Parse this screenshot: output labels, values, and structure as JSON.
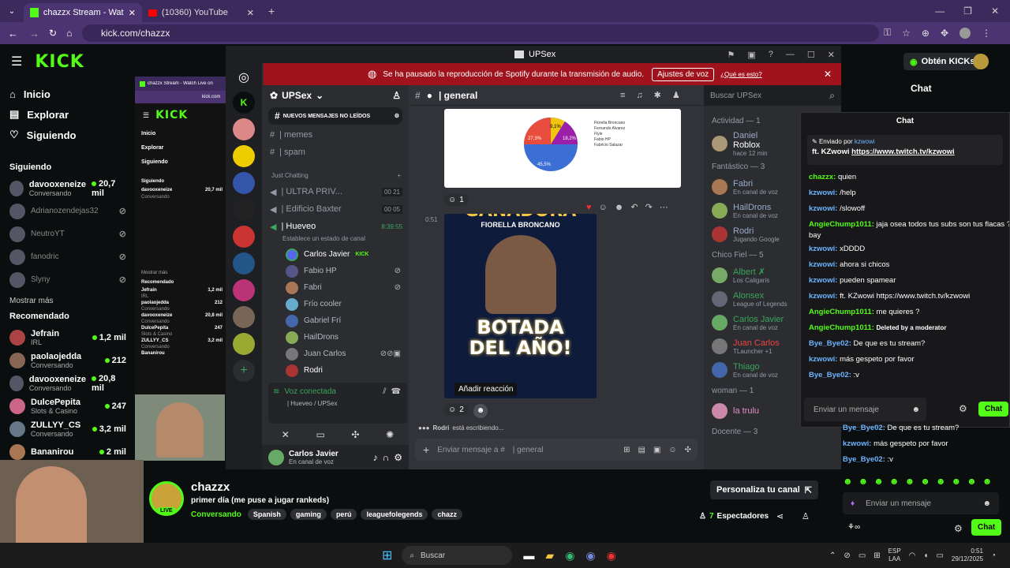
{
  "browser": {
    "tabs": [
      {
        "label": "chazzx Stream - Watch Live on",
        "active": true
      },
      {
        "label": "(10360) YouTube",
        "active": false
      }
    ],
    "url": "kick.com/chazzx"
  },
  "kick": {
    "logo": "KICK",
    "nav": [
      {
        "label": "Inicio",
        "icon": "home-icon"
      },
      {
        "label": "Explorar",
        "icon": "compass-icon"
      },
      {
        "label": "Siguiendo",
        "icon": "heart-icon"
      }
    ],
    "following_title": "Siguiendo",
    "following": [
      {
        "name": "davooxeneize",
        "status": "Conversando",
        "viewers": "20,7 mil"
      },
      {
        "name": "Adrianozendejas32",
        "status": "",
        "viewers": ""
      },
      {
        "name": "NeutroYT",
        "status": "",
        "viewers": ""
      },
      {
        "name": "fanodric",
        "status": "",
        "viewers": ""
      },
      {
        "name": "Slyny",
        "status": "",
        "viewers": ""
      }
    ],
    "show_more": "Mostrar más",
    "recommended_title": "Recomendado",
    "recommended": [
      {
        "name": "Jefrain",
        "status": "IRL",
        "viewers": "1,2 mil"
      },
      {
        "name": "paolaojedda",
        "status": "Conversando",
        "viewers": "212"
      },
      {
        "name": "davooxeneize",
        "status": "Conversando",
        "viewers": "20,8 mil"
      },
      {
        "name": "DulcePepita",
        "status": "Slots & Casino",
        "viewers": "247"
      },
      {
        "name": "ZULLYY_CS",
        "status": "Conversando",
        "viewers": "3,2 mil"
      },
      {
        "name": "Bananirou",
        "status": "",
        "viewers": "2 mil"
      }
    ],
    "get_kicks": "Obtén KICKs",
    "chat_title": "Chat",
    "streamer": "chazzx",
    "live": "LIVE",
    "stream_title": "primer día (me puse a jugar rankeds)",
    "category": "Conversando",
    "tags": [
      "Spanish",
      "gaming",
      "perú",
      "leaguefolegends",
      "chazz"
    ],
    "customize": "Personaliza tu canal",
    "viewers_count": "7",
    "viewers_label": "Espectadores",
    "bottom_chat": [
      {
        "user": "Bye_Bye02:",
        "text": "De que es tu stream?"
      },
      {
        "user": "kzwowi:",
        "text": "más gespeto por favor"
      },
      {
        "user": "Bye_Bye02:",
        "text": ":v"
      }
    ],
    "send_placeholder": "Enviar un mensaje",
    "chat_button": "Chat"
  },
  "mini_kick": {
    "tab": "chazzx Stream - Watch Live on",
    "url": "kick.com",
    "nav": [
      "Inicio",
      "Explorar",
      "Siguiendo"
    ],
    "following_title": "Siguiendo",
    "show_more": "Mostrar más",
    "recommended_title": "Recomendado",
    "items": [
      {
        "name": "davooxeneize",
        "status": "Conversando",
        "viewers": "20,7 mil"
      },
      {
        "name": "Jefrain",
        "status": "IRL",
        "viewers": "1,2 mil"
      },
      {
        "name": "paolaojedda",
        "status": "Conversando",
        "viewers": "212"
      },
      {
        "name": "davooxeneize",
        "status": "Conversando",
        "viewers": "20,8 mil"
      },
      {
        "name": "DulcePepita",
        "status": "Slots & Casino",
        "viewers": "247"
      },
      {
        "name": "ZULLYY_CS",
        "status": "Conversando",
        "viewers": "3,2 mil"
      },
      {
        "name": "Bananirou",
        "status": "",
        "viewers": "2 mil"
      }
    ]
  },
  "discord": {
    "window_title": "UPSex",
    "banner": "Se ha pausado la reproducción de Spotify durante la transmisión de audio.",
    "banner_button": "Ajustes de voz",
    "banner_link": "¿Qué es esto?",
    "server": "UPSex",
    "new_messages": "NUEVOS MENSAJES NO LEÍDOS",
    "channels": [
      {
        "name": "| memes"
      },
      {
        "name": "| spam"
      }
    ],
    "category": "Just Chatting",
    "voice": [
      {
        "name": "| ULTRA PRIV...",
        "a": "00",
        "b": "21"
      },
      {
        "name": "| Edificio Baxter",
        "a": "00",
        "b": "05"
      }
    ],
    "active_voice": "| Hueveo",
    "active_time": "8:39:55",
    "status_hint": "Establece un estado de canal",
    "voice_users": [
      "Carlos Javier",
      "Fabio HP",
      "Fabri",
      "Frío cooler",
      "Gabriel Frí",
      "HailDrons",
      "Juan Carlos",
      "Rodri"
    ],
    "kick_badge": "KICK",
    "voice_connected": "Voz conectada",
    "voice_location": "| Hueveo / UPSex",
    "user_name": "Carlos Javier",
    "user_status": "En canal de voz",
    "channel_header": "| general",
    "search_placeholder": "Buscar UPSex",
    "poll_legend": [
      "Fiorella Broncano",
      "Fernando Alvarez",
      "Flyle",
      "Fabio HP",
      "Fabricio Salazar"
    ],
    "poll_pcts": [
      "45,5%",
      "27,3%",
      "9,1%",
      "18,2%"
    ],
    "reaction1_count": "1",
    "msg_time": "0:51",
    "poster_title": "GANADORA",
    "poster_name": "FIORELLA BRONCANO",
    "poster_bottom": "BOTADA DEL AÑO!",
    "tooltip": "Añadir reacción",
    "reaction2_count": "2",
    "typing_user": "Rodri",
    "typing_text": "está escribiendo...",
    "message_placeholder": "Enviar mensaje a #",
    "message_channel": "| general",
    "members": [
      {
        "header": "Actividad — 1"
      },
      {
        "name": "Daniel",
        "sub": "Roblox",
        "sub2": "hace 12 min"
      },
      {
        "header": "Fantástico — 3"
      },
      {
        "name": "Fabri",
        "sub": "En canal de voz"
      },
      {
        "name": "HailDrons",
        "sub": "En canal de voz"
      },
      {
        "name": "Rodri",
        "sub": "Jugando Google"
      },
      {
        "header": "Chico Fiel — 5"
      },
      {
        "name": "Albert ✗",
        "sub": "Los Caligaris"
      },
      {
        "name": "Alonsex",
        "sub": "League of Legends"
      },
      {
        "name": "Carlos Javier",
        "sub": "En canal de voz"
      },
      {
        "name": "Juan Carlos",
        "sub": "TLauncher +1"
      },
      {
        "name": "Thiago",
        "sub": "En canal de voz"
      },
      {
        "header": "woman — 1"
      },
      {
        "name": "la trulu",
        "sub": ""
      },
      {
        "header": "Docente — 3"
      }
    ]
  },
  "twitch_chat": {
    "title": "Chat",
    "pinned_by": "Enviado por",
    "pinned_user": "kzwowi",
    "pinned_text": "ft. KZwowi",
    "pinned_link": "https://www.twitch.tv/kzwowi",
    "messages": [
      {
        "user": "chazzx:",
        "text": "quien",
        "color": "#53fc18"
      },
      {
        "user": "kzwowi:",
        "text": "/help",
        "color": "#6cb4ff"
      },
      {
        "user": "kzwowi:",
        "text": "/slowoff",
        "color": "#6cb4ff"
      },
      {
        "user": "AngieChump1011:",
        "text": "jaja osea todos tus subs son tus flacas ?",
        "color": "#53fc18"
      },
      {
        "user": "",
        "text": "bay",
        "color": "#fff"
      },
      {
        "user": "kzwowi:",
        "text": "xDDDD",
        "color": "#6cb4ff"
      },
      {
        "user": "kzwowi:",
        "text": "ahora si chicos",
        "color": "#6cb4ff"
      },
      {
        "user": "kzwowi:",
        "text": "pueden spamear",
        "color": "#6cb4ff"
      },
      {
        "user": "kzwowi:",
        "text": "ft. KZwowi https://www.twitch.tv/kzwowi",
        "color": "#6cb4ff"
      },
      {
        "user": "AngieChump1011:",
        "text": "me quieres ?",
        "color": "#53fc18"
      },
      {
        "user": "AngieChump1011:",
        "text": "Deleted by a moderator",
        "color": "#53fc18"
      },
      {
        "user": "Bye_Bye02:",
        "text": "De que es tu stream?",
        "color": "#6cb4ff"
      },
      {
        "user": "kzwowi:",
        "text": "más gespeto por favor",
        "color": "#6cb4ff"
      },
      {
        "user": "Bye_Bye02:",
        "text": ":v",
        "color": "#6cb4ff"
      }
    ],
    "input_placeholder": "Enviar un mensaje",
    "chat_button": "Chat"
  },
  "taskbar": {
    "search": "Buscar",
    "lang": "ESP",
    "lang2": "LAA",
    "time": "0:51",
    "date": "29/12/2025"
  }
}
